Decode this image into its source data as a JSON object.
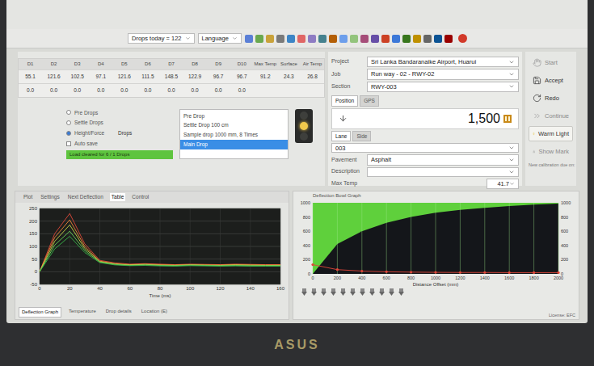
{
  "toolbar": {
    "drops_today": "Drops today = 122",
    "language": "Language"
  },
  "table": {
    "columns": [
      "D1",
      "D2",
      "D3",
      "D4",
      "D5",
      "D6",
      "D7",
      "D8",
      "D9",
      "D10",
      "Max Temp",
      "Surface",
      "Air Temp"
    ],
    "rows": [
      [
        "55.1",
        "121.6",
        "102.5",
        "97.1",
        "121.6",
        "111.5",
        "148.5",
        "122.9",
        "96.7",
        "96.7",
        "91.2",
        "24.3",
        "26.8"
      ],
      [
        "0.0",
        "0.0",
        "0.0",
        "0.0",
        "0.0",
        "0.0",
        "0.0",
        "0.0",
        "0.0",
        "0.0",
        "",
        "",
        ""
      ]
    ]
  },
  "settings": {
    "rows": [
      {
        "label": "Pre Drops",
        "value": "",
        "selected": false
      },
      {
        "label": "Settle Drops",
        "value": "",
        "selected": false
      },
      {
        "label": "Height/Force",
        "value": "Drops",
        "selected": true
      }
    ],
    "checkbox": {
      "label": "Auto save",
      "checked": false
    },
    "status": "Load cleared for 6 / 1 Drops"
  },
  "drop_list": [
    {
      "label": "Pre Drop",
      "selected": false
    },
    {
      "label": "Settle Drop 100 cm",
      "selected": false
    },
    {
      "label": "Sample drop 1000 mm, 8 Times",
      "selected": false
    },
    {
      "label": "Main Drop",
      "selected": true
    }
  ],
  "lights": [
    {
      "on": false,
      "color": "#5a5a4a"
    },
    {
      "on": true,
      "color": "#f2c94c"
    },
    {
      "on": false,
      "color": "#4a5a4a"
    }
  ],
  "form": {
    "fields": [
      {
        "label": "Project",
        "value": "Sri Lanka Bandaranaike Airport, Huarui"
      },
      {
        "label": "Job",
        "value": "Run way - 02 - RWY-02"
      },
      {
        "label": "Section",
        "value": "RWY-003"
      }
    ],
    "tabs": [
      {
        "label": "Position",
        "selected": true
      },
      {
        "label": "GPS",
        "selected": false
      }
    ],
    "position": "1,500",
    "lane_tabs": [
      {
        "label": "Lane",
        "selected": true
      },
      {
        "label": "Side",
        "selected": false
      }
    ],
    "lane": "003",
    "pavement": {
      "label": "Pavement",
      "value": "Asphalt"
    },
    "description": {
      "label": "Description",
      "value": ""
    },
    "max_temp": {
      "label": "Max Temp",
      "value": "41.7"
    }
  },
  "actions": [
    {
      "label": "Start",
      "disabled": true,
      "active": false
    },
    {
      "label": "Accept",
      "disabled": false,
      "active": false
    },
    {
      "label": "Redo",
      "disabled": false,
      "active": false
    },
    {
      "label": "Continue",
      "disabled": true,
      "active": false
    },
    {
      "label": "Warm Light",
      "disabled": false,
      "active": true
    },
    {
      "label": "Show Mark",
      "disabled": true,
      "active": false
    }
  ],
  "calibration": "New calibration due on:",
  "chart_left": {
    "tabs": [
      {
        "label": "Plot",
        "selected": false
      },
      {
        "label": "Settings",
        "selected": false
      },
      {
        "label": "Next Deflection",
        "selected": false
      },
      {
        "label": "Table",
        "selected": true
      },
      {
        "label": "Control",
        "selected": false
      }
    ],
    "y_ticks": [
      "250",
      "200",
      "150",
      "100",
      "50",
      "0",
      "-50"
    ],
    "x_ticks": [
      "0",
      "20",
      "40",
      "60",
      "80",
      "100",
      "120",
      "140",
      "160"
    ],
    "x_label": "Time (ms)",
    "series": [
      {
        "color": "#e04a3a",
        "values": [
          0,
          150,
          230,
          110,
          45,
          35,
          30,
          32,
          30,
          28,
          30,
          29,
          28,
          30,
          29,
          28,
          28
        ]
      },
      {
        "color": "#f08a3a",
        "values": [
          0,
          135,
          205,
          100,
          42,
          32,
          28,
          30,
          28,
          27,
          28,
          27,
          27,
          28,
          27,
          27,
          27
        ]
      },
      {
        "color": "#c8d84a",
        "values": [
          0,
          120,
          185,
          92,
          40,
          30,
          27,
          29,
          26,
          25,
          27,
          26,
          25,
          27,
          26,
          25,
          25
        ]
      },
      {
        "color": "#6ad85a",
        "values": [
          0,
          105,
          160,
          84,
          38,
          29,
          25,
          27,
          25,
          24,
          26,
          25,
          24,
          25,
          24,
          24,
          24
        ]
      },
      {
        "color": "#3ab84a",
        "values": [
          0,
          90,
          140,
          76,
          36,
          27,
          24,
          25,
          23,
          22,
          24,
          23,
          22,
          23,
          22,
          22,
          22
        ]
      }
    ]
  },
  "bottom_tabs": [
    {
      "label": "Deflection Graph",
      "selected": true
    },
    {
      "label": "Temperature",
      "selected": false
    },
    {
      "label": "Drop details",
      "selected": false
    },
    {
      "label": "Location (E)",
      "selected": false
    }
  ],
  "chart_right": {
    "title": "Deflection Bowl Graph",
    "x_label": "Distance Offset (mm)",
    "x_ticks": [
      "0",
      "200",
      "400",
      "600",
      "800",
      "1000",
      "1200",
      "1400",
      "1600",
      "1800",
      "2000"
    ],
    "y_ticks": [
      "1000",
      "800",
      "600",
      "400",
      "200",
      "0"
    ],
    "envelope": [
      0,
      420,
      600,
      720,
      800,
      860,
      900,
      930,
      955,
      975,
      990
    ],
    "bowl": [
      130,
      60,
      40,
      30,
      25,
      22,
      20,
      20,
      18,
      18,
      18
    ]
  },
  "license": "License: EFC",
  "brand": "ASUS"
}
